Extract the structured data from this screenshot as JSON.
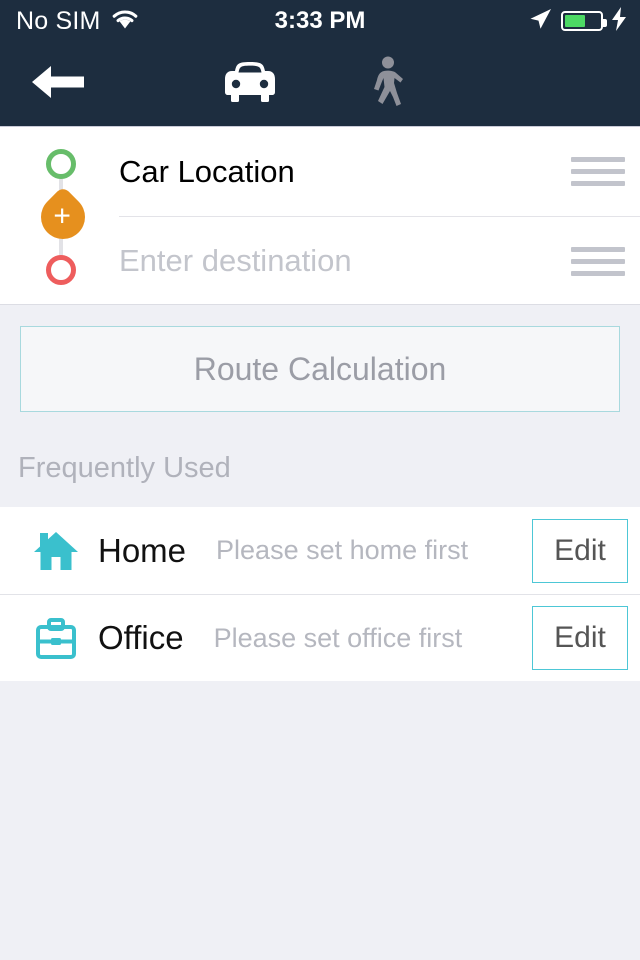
{
  "status_bar": {
    "carrier": "No SIM",
    "wifi_icon": "wifi-icon",
    "time": "3:33 PM",
    "location_icon": "location-arrow-icon",
    "battery_icon": "battery-icon",
    "battery_level_pct": 60,
    "charging_icon": "lightning-bolt-icon",
    "background_color": "#1d2d3f"
  },
  "nav_bar": {
    "back_icon": "back-arrow-icon",
    "tabs": [
      {
        "icon": "car-icon",
        "label": "Driving",
        "active": true
      },
      {
        "icon": "walking-person-icon",
        "label": "Walking",
        "active": false
      }
    ],
    "active_color": "#ffffff",
    "inactive_color": "#8e9099"
  },
  "route_panel": {
    "origin": {
      "value": "Car Location",
      "placeholder": "Car Location",
      "node_color": "#67bd6a",
      "drag_handle_icon": "drag-handle-icon"
    },
    "add_waypoint": {
      "icon": "plus-icon",
      "color": "#e6901e"
    },
    "destination": {
      "value": "",
      "placeholder": "Enter destination",
      "node_color": "#ee5d5d",
      "drag_handle_icon": "drag-handle-icon"
    }
  },
  "route_calculation": {
    "label": "Route Calculation",
    "border_color": "#a8d9de",
    "text_color": "#9b9da6"
  },
  "frequently_used": {
    "section_title": "Frequently Used",
    "items": [
      {
        "icon": "home-icon",
        "name": "Home",
        "hint": "Please set home first",
        "action_label": "Edit",
        "icon_color": "#3ac0cd"
      },
      {
        "icon": "briefcase-icon",
        "name": "Office",
        "hint": "Please set office first",
        "action_label": "Edit",
        "icon_color": "#3ac0cd"
      }
    ]
  },
  "theme": {
    "page_background": "#eff0f5",
    "accent_teal": "#3ac0cd",
    "header_navy": "#1d2d3f"
  }
}
